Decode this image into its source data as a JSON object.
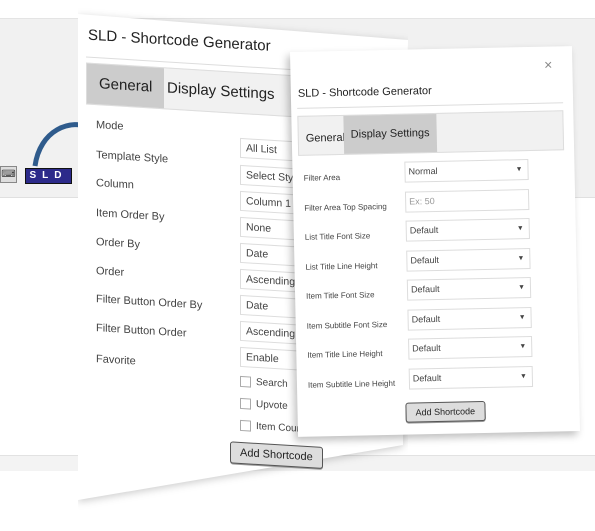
{
  "toolbar": {
    "keyboard_icon": "keyboard-icon",
    "sld_button": "SLD",
    "sld_color": "#2c2a8a",
    "arrow_color": "#2f5b8c"
  },
  "back_dialog": {
    "title": "SLD - Shortcode Generator",
    "tabs": [
      {
        "label": "General",
        "active": true
      },
      {
        "label": "Display Settings",
        "active": false
      }
    ],
    "fields": [
      {
        "label": "Mode",
        "value": "All List"
      },
      {
        "label": "Template Style",
        "value": "Select Style"
      },
      {
        "label": "Column",
        "value": "Column 1"
      },
      {
        "label": "Item Order By",
        "value": "None"
      },
      {
        "label": "Order By",
        "value": "Date"
      },
      {
        "label": "Order",
        "value": "Ascending"
      },
      {
        "label": "Filter Button Order By",
        "value": "Date"
      },
      {
        "label": "Filter Button Order",
        "value": "Ascending"
      },
      {
        "label": "Favorite",
        "value": "Enable"
      }
    ],
    "checkboxes": [
      {
        "label": "Search",
        "checked": false
      },
      {
        "label": "Upvote",
        "checked": false
      },
      {
        "label": "Item Count",
        "checked": false
      }
    ],
    "submit": "Add Shortcode"
  },
  "front_dialog": {
    "title": "SLD - Shortcode Generator",
    "close": "×",
    "tabs": [
      {
        "label": "General",
        "active": false
      },
      {
        "label": "Display Settings",
        "active": true
      }
    ],
    "fields": [
      {
        "label": "Filter Area",
        "value": "Normal",
        "type": "select"
      },
      {
        "label": "Filter Area Top Spacing",
        "placeholder": "Ex: 50",
        "type": "text"
      },
      {
        "label": "List Title Font Size",
        "value": "Default",
        "type": "select"
      },
      {
        "label": "List Title Line Height",
        "value": "Default",
        "type": "select"
      },
      {
        "label": "Item Title Font Size",
        "value": "Default",
        "type": "select"
      },
      {
        "label": "Item Subtitle Font Size",
        "value": "Default",
        "type": "select"
      },
      {
        "label": "Item Title Line Height",
        "value": "Default",
        "type": "select"
      },
      {
        "label": "Item Subtitle Line Height",
        "value": "Default",
        "type": "select"
      }
    ],
    "submit": "Add Shortcode"
  }
}
